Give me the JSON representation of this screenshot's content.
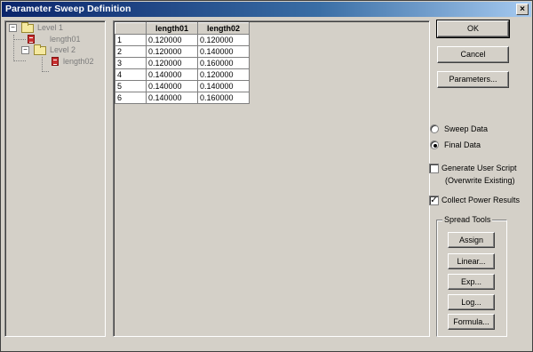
{
  "window": {
    "title": "Parameter Sweep Definition",
    "close_label": "×"
  },
  "tree": {
    "nodes": [
      {
        "label": "Level 1",
        "expander": "−"
      },
      {
        "label": "length01"
      },
      {
        "label": "Level 2",
        "expander": "−"
      },
      {
        "label": "length02"
      }
    ]
  },
  "grid": {
    "columns": [
      "length01",
      "length02"
    ],
    "rows": [
      {
        "num": "1",
        "length01": "0.120000",
        "length02": "0.120000"
      },
      {
        "num": "2",
        "length01": "0.120000",
        "length02": "0.140000"
      },
      {
        "num": "3",
        "length01": "0.120000",
        "length02": "0.160000"
      },
      {
        "num": "4",
        "length01": "0.140000",
        "length02": "0.120000"
      },
      {
        "num": "5",
        "length01": "0.140000",
        "length02": "0.140000"
      },
      {
        "num": "6",
        "length01": "0.140000",
        "length02": "0.160000"
      }
    ]
  },
  "buttons": {
    "ok": "OK",
    "cancel": "Cancel",
    "parameters": "Parameters..."
  },
  "options": {
    "sweep_data": "Sweep Data",
    "final_data": "Final Data",
    "selected": "final_data",
    "generate_script_line1": "Generate User Script",
    "generate_script_line2": "(Overwrite Existing)",
    "generate_script_checked": false,
    "collect_power": "Collect Power Results",
    "collect_power_checked": true,
    "check_mark": "✓"
  },
  "spread_tools": {
    "title": "Spread Tools",
    "assign": "Assign",
    "linear": "Linear...",
    "exp": "Exp...",
    "log": "Log...",
    "formula": "Formula..."
  }
}
